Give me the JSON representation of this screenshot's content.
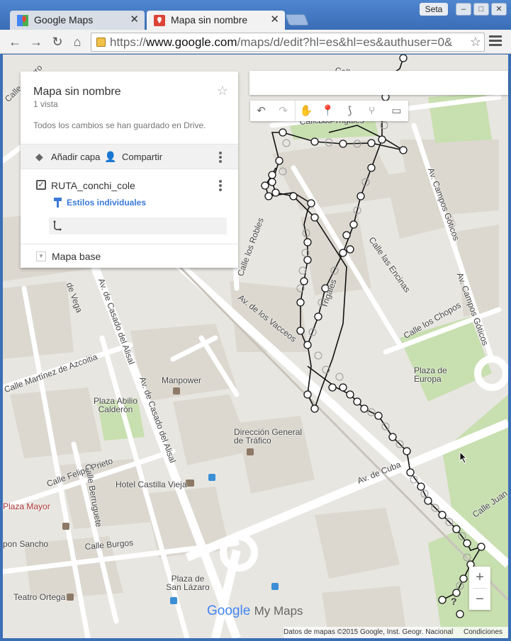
{
  "browser": {
    "tabs": [
      {
        "title": "Google Maps"
      },
      {
        "title": "Mapa sin nombre"
      }
    ],
    "user_label": "Seta",
    "window_buttons": [
      "–",
      "□",
      "✕"
    ],
    "url_prefix": "https://",
    "url_host": "www.google.com",
    "url_path": "/maps/d/edit?hl=es&hl=es&authuser=0&",
    "icons": {
      "back": "back-arrow-icon",
      "forward": "forward-arrow-icon",
      "reload": "reload-icon",
      "home": "home-icon",
      "lock": "lock-icon",
      "bookmark": "star-icon",
      "menu": "menu-icon"
    }
  },
  "panel": {
    "title": "Mapa sin nombre",
    "views": "1 vista",
    "saved_status": "Todos los cambios se han guardado en Drive.",
    "add_layer": "Añadir capa",
    "share": "Compartir",
    "layer_name": "RUTA_conchi_cole",
    "layer_checked": true,
    "styles_link": "Estilos individuales",
    "basemap": "Mapa base"
  },
  "map": {
    "streets": [
      "Av. de Casado del Alisal",
      "Av. de Casado del Alisal",
      "Calle Martínez de Azcoitia",
      "Calle Felipe Prieto",
      "Calle Berruguete",
      "Calle Burgos",
      "Av. de los Vacceos",
      "Calle los Robles",
      "Calle las Encinas",
      "Calle los Chopos",
      "Av. Campos Góticos",
      "Av. Campos Góticos",
      "Av. de Cuba",
      "Calle Juan",
      "de Vega",
      "Calle Pizarro",
      "Calle Los Trigales",
      "Trigales",
      "pon Sancho",
      "Calle"
    ],
    "places": [
      "Plaza Abilio Calderón",
      "Manpower",
      "Dirección General de Tráfico",
      "Hotel Castilla Vieja",
      "Plaza Mayor",
      "Plaza de San Lázaro",
      "Teatro Ortega",
      "Plaza de Europa",
      "Los Trigales"
    ],
    "logo": {
      "google": "Google",
      "my_maps": "My Maps"
    },
    "attribution": "Datos de mapas ©2015 Google, Inst. Geogr. Nacional",
    "terms": "Condiciones",
    "zoom_in": "+",
    "zoom_out": "−",
    "help": "?"
  },
  "tools": [
    "undo-icon",
    "redo-icon",
    "hand-icon",
    "marker-icon",
    "draw-line-icon",
    "directions-icon",
    "ruler-icon"
  ]
}
